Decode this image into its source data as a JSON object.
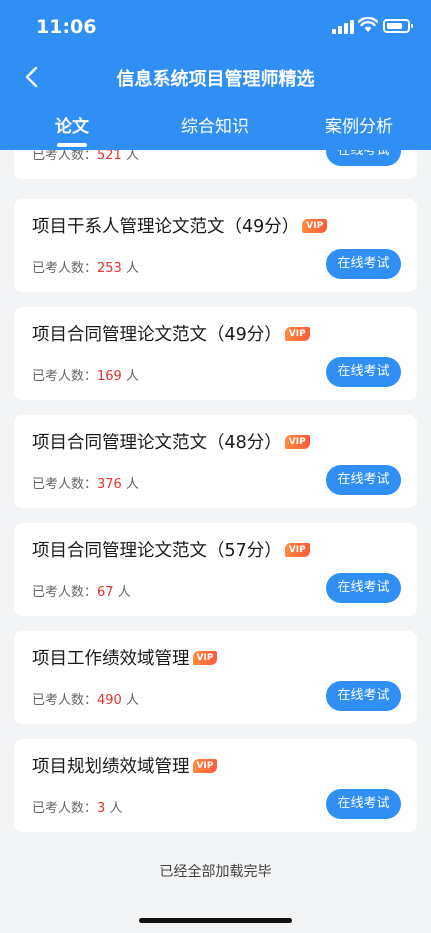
{
  "status": {
    "time": "11:06"
  },
  "nav": {
    "title": "信息系统项目管理师精选"
  },
  "tabs": [
    "论文",
    "综合知识",
    "案例分析"
  ],
  "list": {
    "meta_label": "已考人数：",
    "unit": "人",
    "button_label": "在线考试",
    "vip_label": "VIP",
    "items": [
      {
        "title": "",
        "count": "521",
        "vip": false
      },
      {
        "title": "项目干系人管理论文范文（49分）",
        "count": "253",
        "vip": true
      },
      {
        "title": "项目合同管理论文范文（49分）",
        "count": "169",
        "vip": true
      },
      {
        "title": "项目合同管理论文范文（48分）",
        "count": "376",
        "vip": true
      },
      {
        "title": "项目合同管理论文范文（57分）",
        "count": "67",
        "vip": true
      },
      {
        "title": "项目工作绩效域管理",
        "count": "490",
        "vip": true
      },
      {
        "title": "项目规划绩效域管理",
        "count": "3",
        "vip": true
      }
    ]
  },
  "footer": {
    "text": "已经全部加载完毕"
  },
  "colors": {
    "primary": "#2f8ff5",
    "count_red": "#e8322f",
    "vip_orange": "#ff6a3b"
  }
}
